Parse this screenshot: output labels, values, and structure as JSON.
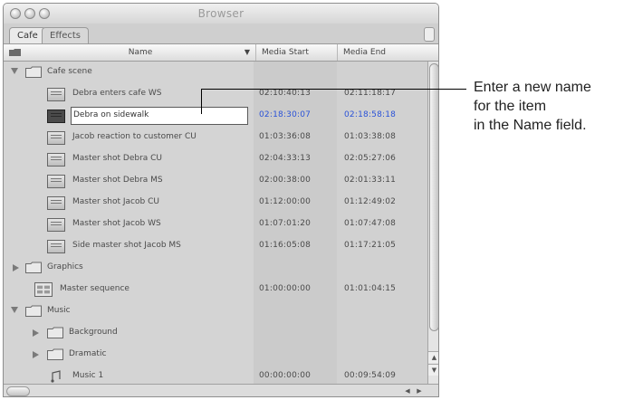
{
  "window": {
    "title": "Browser",
    "tabs": [
      {
        "label": "Cafe",
        "active": true
      },
      {
        "label": "Effects",
        "active": false
      }
    ]
  },
  "columns": {
    "name": "Name",
    "media_start": "Media Start",
    "media_end": "Media End"
  },
  "rows": [
    {
      "kind": "bin",
      "expanded": true,
      "name": "Cafe scene",
      "start": "",
      "end": ""
    },
    {
      "kind": "clip",
      "name": "Debra enters cafe WS",
      "start": "02:10:40:13",
      "end": "02:11:18:17"
    },
    {
      "kind": "clip-editing",
      "name": "Debra on sidewalk",
      "start": "02:18:30:07",
      "end": "02:18:58:18"
    },
    {
      "kind": "clip",
      "name": "Jacob reaction to customer CU",
      "start": "01:03:36:08",
      "end": "01:03:38:08"
    },
    {
      "kind": "clip",
      "name": "Master shot Debra CU",
      "start": "02:04:33:13",
      "end": "02:05:27:06"
    },
    {
      "kind": "clip",
      "name": "Master shot Debra MS",
      "start": "02:00:38:00",
      "end": "02:01:33:11"
    },
    {
      "kind": "clip",
      "name": "Master shot Jacob CU",
      "start": "01:12:00:00",
      "end": "01:12:49:02"
    },
    {
      "kind": "clip",
      "name": "Master shot Jacob WS",
      "start": "01:07:01:20",
      "end": "01:07:47:08"
    },
    {
      "kind": "clip",
      "name": "Side master shot Jacob MS",
      "start": "01:16:05:08",
      "end": "01:17:21:05"
    },
    {
      "kind": "bin",
      "expanded": false,
      "name": "Graphics",
      "start": "",
      "end": ""
    },
    {
      "kind": "sequence",
      "name": "Master sequence",
      "start": "01:00:00:00",
      "end": "01:01:04:15"
    },
    {
      "kind": "bin",
      "expanded": true,
      "name": "Music",
      "start": "",
      "end": ""
    },
    {
      "kind": "subbin",
      "expanded": false,
      "name": "Background",
      "start": "",
      "end": ""
    },
    {
      "kind": "subbin",
      "expanded": false,
      "name": "Dramatic",
      "start": "",
      "end": ""
    },
    {
      "kind": "audio",
      "name": "Music 1",
      "start": "00:00:00:00",
      "end": "00:09:54:09"
    }
  ],
  "callout": {
    "lines": [
      "Enter a new name",
      "for the item",
      "in the Name field."
    ]
  },
  "colors": {
    "selected_timecode": "#2a52d8",
    "list_background": "#d4d4d4"
  }
}
